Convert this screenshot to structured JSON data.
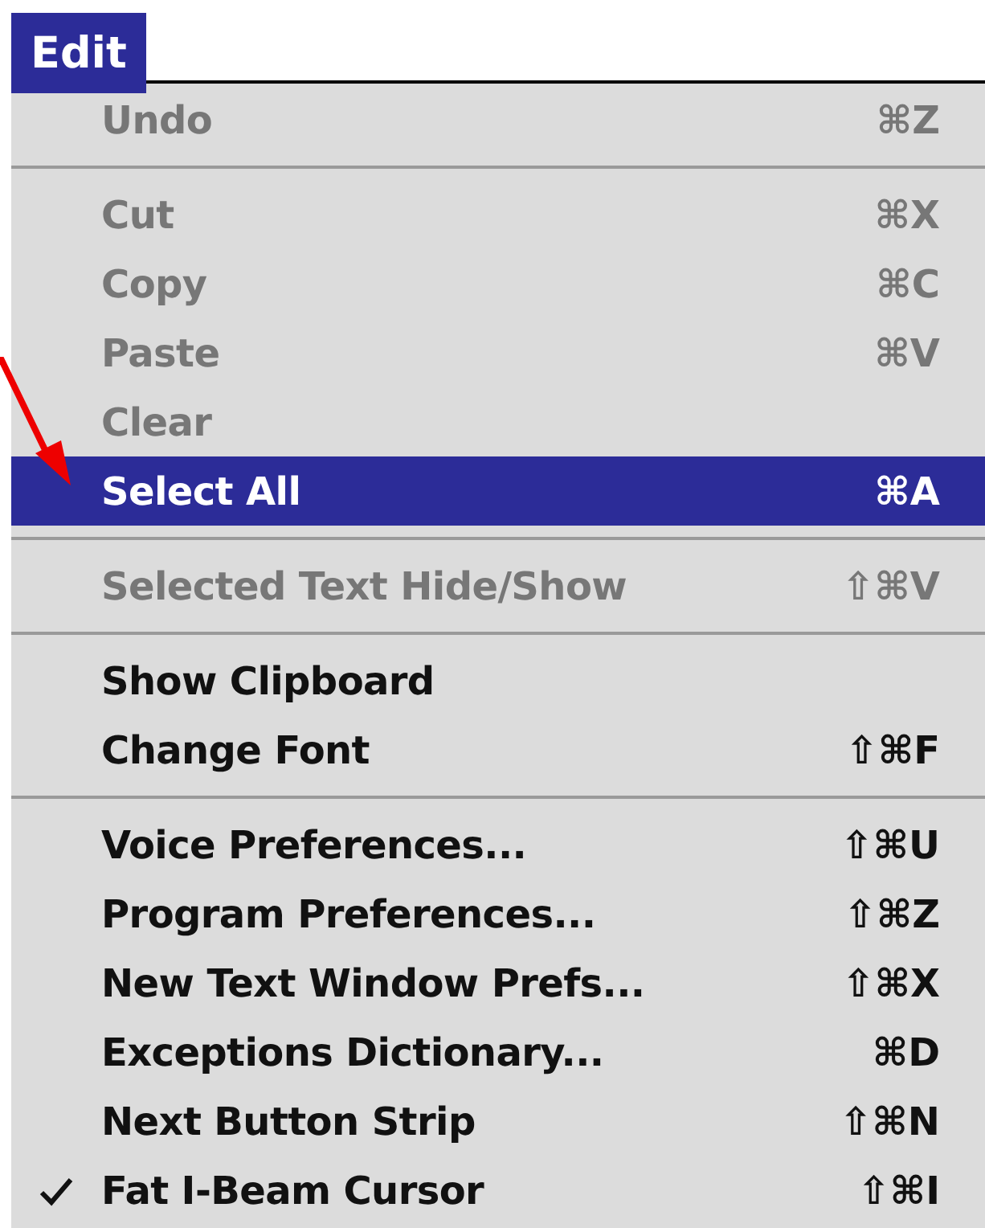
{
  "menu_bar": {
    "title": "Edit",
    "selected": true
  },
  "menu": {
    "groups": [
      {
        "items": [
          {
            "label": "Undo",
            "shortcut": "⌘Z",
            "disabled": true,
            "selected": false,
            "checked": false
          }
        ]
      },
      {
        "items": [
          {
            "label": "Cut",
            "shortcut": "⌘X",
            "disabled": true,
            "selected": false,
            "checked": false
          },
          {
            "label": "Copy",
            "shortcut": "⌘C",
            "disabled": true,
            "selected": false,
            "checked": false
          },
          {
            "label": "Paste",
            "shortcut": "⌘V",
            "disabled": true,
            "selected": false,
            "checked": false
          },
          {
            "label": "Clear",
            "disabled": true,
            "selected": false,
            "checked": false
          },
          {
            "label": "Select All",
            "shortcut": "⌘A",
            "disabled": false,
            "selected": true,
            "checked": false
          }
        ]
      },
      {
        "items": [
          {
            "label": "Selected Text Hide/Show",
            "shortcut": "⇧⌘V",
            "disabled": true,
            "selected": false,
            "checked": false
          }
        ]
      },
      {
        "items": [
          {
            "label": "Show Clipboard",
            "disabled": false,
            "selected": false,
            "checked": false
          },
          {
            "label": "Change Font",
            "shortcut": "⇧⌘F",
            "disabled": false,
            "selected": false,
            "checked": false
          }
        ]
      },
      {
        "items": [
          {
            "label": "Voice Preferences...",
            "shortcut": "⇧⌘U",
            "disabled": false,
            "selected": false,
            "checked": false
          },
          {
            "label": "Program Preferences...",
            "shortcut": "⇧⌘Z",
            "disabled": false,
            "selected": false,
            "checked": false
          },
          {
            "label": "New Text Window Prefs...",
            "shortcut": "⇧⌘X",
            "disabled": false,
            "selected": false,
            "checked": false
          },
          {
            "label": "Exceptions Dictionary...",
            "shortcut": "⌘D",
            "disabled": false,
            "selected": false,
            "checked": false
          },
          {
            "label": "Next Button Strip",
            "shortcut": "⇧⌘N",
            "disabled": false,
            "selected": false,
            "checked": false
          },
          {
            "label": "Fat I-Beam Cursor",
            "shortcut": "⇧⌘I",
            "disabled": false,
            "selected": false,
            "checked": true
          }
        ]
      }
    ]
  }
}
